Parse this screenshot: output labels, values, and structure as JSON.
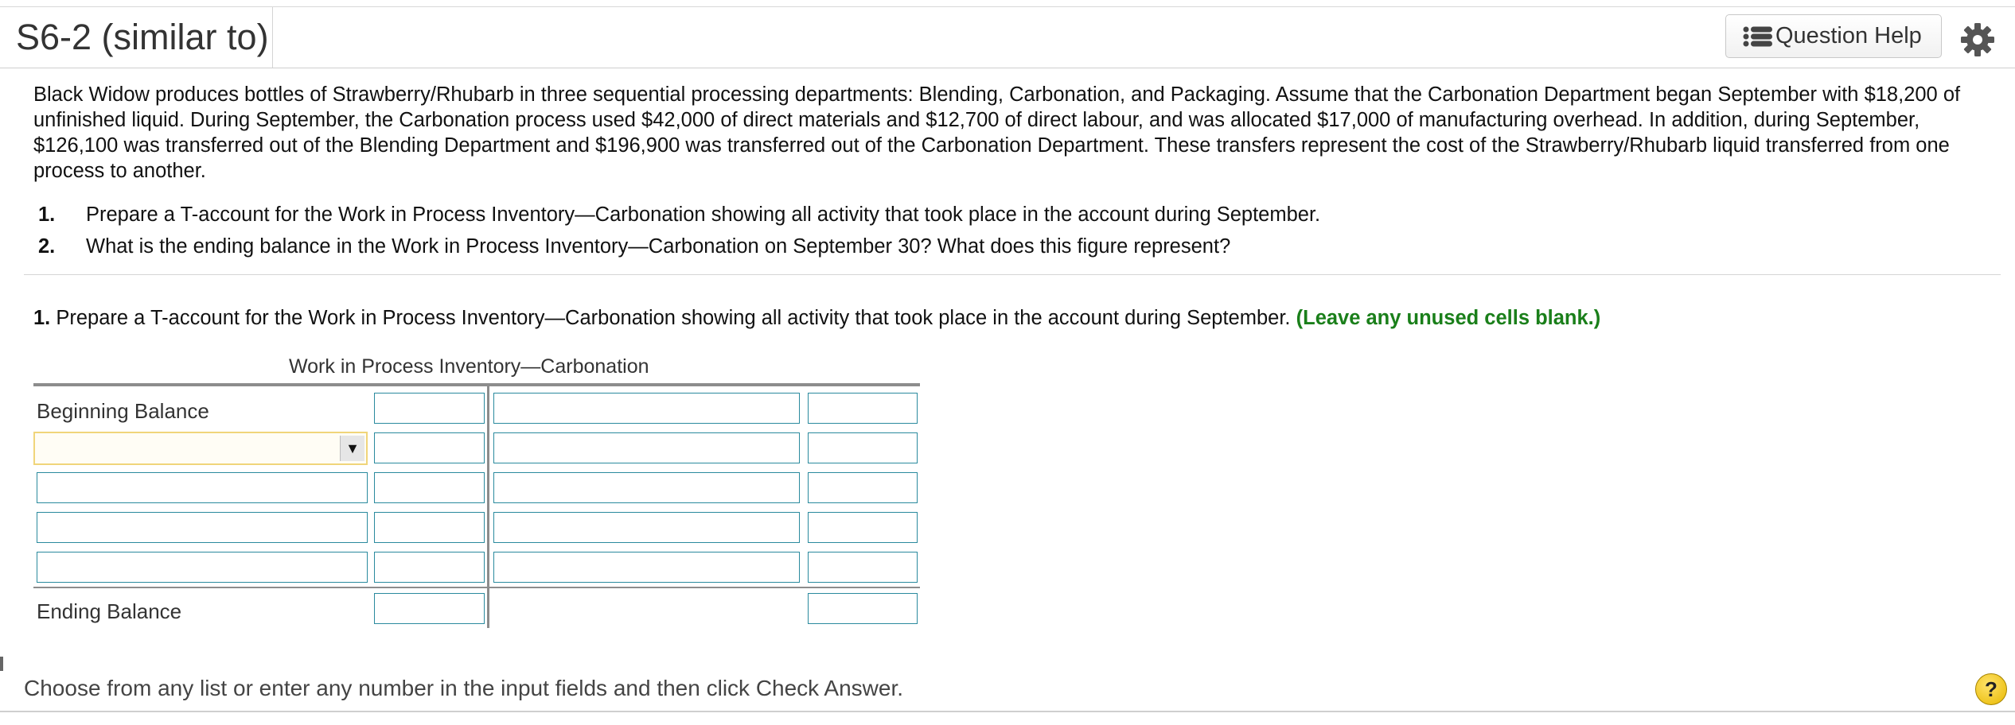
{
  "header": {
    "title": "S6-2 (similar to)",
    "help_button_label": "Question Help",
    "help_button_icon": "list-icon",
    "settings_icon": "gear-icon"
  },
  "problem": {
    "intro": "Black Widow produces bottles of Strawberry/Rhubarb in three sequential processing departments: Blending, Carbonation, and Packaging. Assume that the Carbonation Department began September with $18,200 of unfinished liquid. During September, the Carbonation process used $42,000 of direct materials and $12,700 of direct labour, and was allocated $17,000 of manufacturing overhead. In addition, during September, $126,100 was transferred out of the Blending Department and $196,900 was transferred out of the Carbonation Department. These transfers represent the cost of the Strawberry/Rhubarb liquid transferred from one process to another.",
    "questions": [
      {
        "num": "1.",
        "text": "Prepare a T-account for the Work in Process Inventory—Carbonation showing all activity that took place in the account during September."
      },
      {
        "num": "2.",
        "text": "What is the ending balance in the Work in Process Inventory—Carbonation on September 30? What does this figure represent?"
      }
    ]
  },
  "part1": {
    "num": "1.",
    "instruction": "Prepare a T-account for the Work in Process Inventory—Carbonation showing all activity that took place in the account during September.",
    "note": "(Leave any unused cells blank.)"
  },
  "taccount": {
    "title": "Work in Process Inventory—Carbonation",
    "beginning_label": "Beginning Balance",
    "ending_label": "Ending Balance",
    "dropdown_value": "",
    "colors": {
      "input_border": "#2a8a9e",
      "dropdown_border": "#f0d57a",
      "note_green": "#1a7f1a"
    }
  },
  "footer": {
    "instruction": "Choose from any list or enter any number in the input fields and then click Check Answer.",
    "help_symbol": "?"
  }
}
